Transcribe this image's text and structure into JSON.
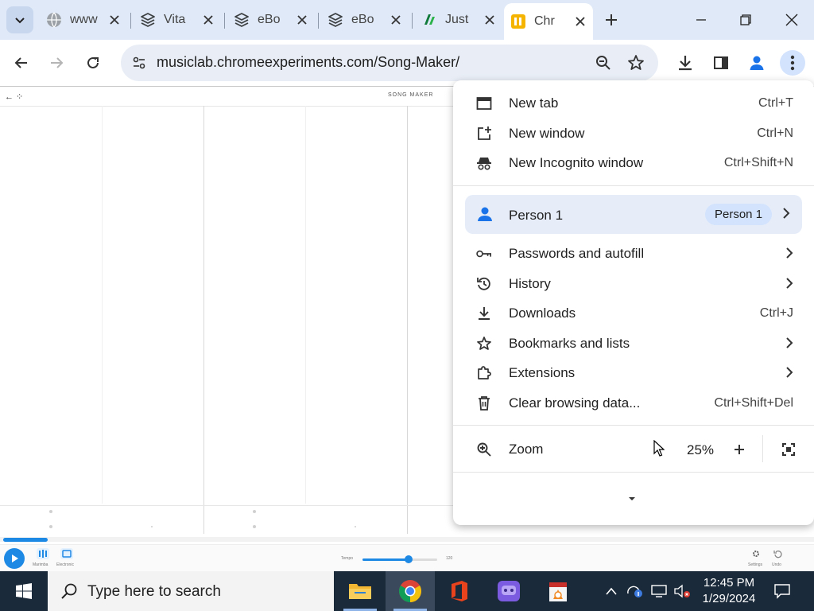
{
  "tabs": [
    {
      "title": "www",
      "icon": "globe-icon"
    },
    {
      "title": "Vita",
      "icon": "layers-icon"
    },
    {
      "title": "eBo",
      "icon": "layers-icon"
    },
    {
      "title": "eBo",
      "icon": "layers-icon"
    },
    {
      "title": "Just",
      "icon": "green-brand-icon"
    },
    {
      "title": "Chr",
      "icon": "song-maker-icon",
      "active": true
    }
  ],
  "toolbar": {
    "url": "musiclab.chromeexperiments.com/Song-Maker/"
  },
  "page": {
    "title": "SONG MAKER",
    "progress_fraction": 0.055,
    "tempo_fraction": 0.62,
    "bottom_labels": [
      "Marimba",
      "Electronic",
      "Tempo",
      "120",
      "Settings",
      "Undo"
    ]
  },
  "menu": {
    "group1": [
      {
        "icon": "new-tab-icon",
        "label": "New tab",
        "shortcut": "Ctrl+T"
      },
      {
        "icon": "new-window-icon",
        "label": "New window",
        "shortcut": "Ctrl+N"
      },
      {
        "icon": "incognito-icon",
        "label": "New Incognito window",
        "shortcut": "Ctrl+Shift+N"
      }
    ],
    "person": {
      "label": "Person 1",
      "chip": "Person 1"
    },
    "group2": [
      {
        "icon": "key-icon",
        "label": "Passwords and autofill",
        "submenu": true
      },
      {
        "icon": "history-icon",
        "label": "History",
        "submenu": true
      },
      {
        "icon": "download-icon",
        "label": "Downloads",
        "shortcut": "Ctrl+J"
      },
      {
        "icon": "star-icon",
        "label": "Bookmarks and lists",
        "submenu": true
      },
      {
        "icon": "extension-icon",
        "label": "Extensions",
        "submenu": true
      },
      {
        "icon": "trash-icon",
        "label": "Clear browsing data...",
        "shortcut": "Ctrl+Shift+Del"
      }
    ],
    "zoom": {
      "label": "Zoom",
      "value": "25%"
    }
  },
  "taskbar": {
    "search_placeholder": "Type here to search",
    "time": "12:45 PM",
    "date": "1/29/2024",
    "apps": [
      "file-explorer-icon",
      "chrome-icon",
      "office-icon",
      "chat-app-icon",
      "vlc-document-icon"
    ]
  },
  "colors": {
    "accent": "#1e88e5",
    "tabstrip": "#dfe9f7",
    "omnibox": "#e9eef6",
    "person_highlight": "#e6edf9",
    "taskbar": "#1b2a3a"
  }
}
